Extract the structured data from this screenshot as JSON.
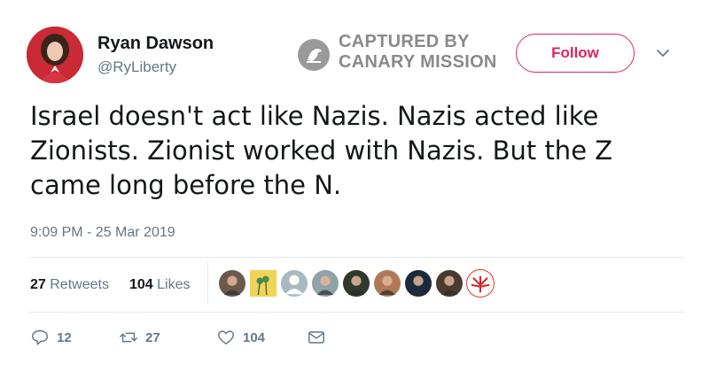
{
  "author": {
    "name": "Ryan Dawson",
    "handle": "@RyLiberty"
  },
  "watermark": {
    "line1": "CAPTURED BY",
    "line2": "CANARY MISSION"
  },
  "follow_label": "Follow",
  "tweet": {
    "text_line1": "Israel doesn't act like Nazis. Nazis acted like",
    "text_line2": "Zionists. Zionist worked with Nazis. But the Z",
    "text_line3": "came long before the N.",
    "timestamp": "9:09 PM - 25 Mar 2019"
  },
  "stats": {
    "retweets_count": "27",
    "retweets_label": "Retweets",
    "likes_count": "104",
    "likes_label": "Likes"
  },
  "liker_avatars": [
    {
      "icon": "avatar-person",
      "color": "#6b5a4a"
    },
    {
      "icon": "avatar-palm-trees",
      "color": "#e8c84a"
    },
    {
      "icon": "avatar-default",
      "color": "#aab8c2"
    },
    {
      "icon": "avatar-landscape",
      "color": "#8fa3a8"
    },
    {
      "icon": "avatar-person",
      "color": "#2f3a2c"
    },
    {
      "icon": "avatar-person",
      "color": "#b07a5a"
    },
    {
      "icon": "avatar-dark",
      "color": "#1b2a3a"
    },
    {
      "icon": "avatar-bearded-man",
      "color": "#4a3a30"
    },
    {
      "icon": "avatar-cannabis-leaf",
      "color": "#e03a2a"
    }
  ],
  "actions": {
    "replies": "12",
    "retweets": "27",
    "likes": "104"
  },
  "colors": {
    "accent": "#e0245e",
    "secondary_text": "#657786",
    "primary_text": "#14171a",
    "divider": "#e1e8ed"
  }
}
